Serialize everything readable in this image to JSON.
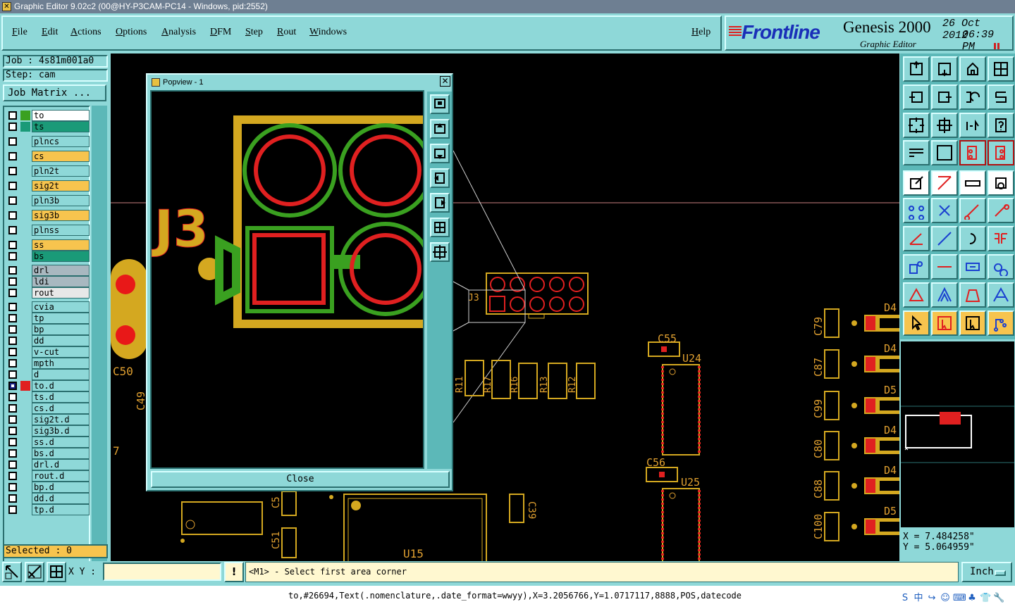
{
  "window": {
    "title": "Graphic Editor 9.02c2 (00@HY-P3CAM-PC14 - Windows, pid:2552)"
  },
  "menu": {
    "items": [
      "File",
      "Edit",
      "Actions",
      "Options",
      "Analysis",
      "DFM",
      "Step",
      "Rout",
      "Windows"
    ],
    "help": "Help"
  },
  "brand": {
    "logo": "Frontline",
    "product": "Genesis 2000",
    "subtitle": "Graphic Editor",
    "date": "26 Oct 2012",
    "time": "06:39 PM"
  },
  "job": {
    "job_label": "Job : 4s81m001a0",
    "step_label": "Step: cam",
    "matrix_button": "Job Matrix ..."
  },
  "layers": [
    {
      "name": "to",
      "color": "#ffffff",
      "swatch": "#3aa020",
      "checked": false
    },
    {
      "name": "ts",
      "color": "#1a9a78",
      "swatch": "#1a9a78",
      "checked": false
    },
    {
      "name": "plncs",
      "color": "#8ed8d8",
      "swatch": "",
      "checked": false
    },
    {
      "name": "cs",
      "color": "#f7c44e",
      "swatch": "",
      "checked": false
    },
    {
      "name": "pln2t",
      "color": "#8ed8d8",
      "swatch": "",
      "checked": false
    },
    {
      "name": "sig2t",
      "color": "#f7c44e",
      "swatch": "",
      "checked": false
    },
    {
      "name": "pln3b",
      "color": "#8ed8d8",
      "swatch": "",
      "checked": false
    },
    {
      "name": "sig3b",
      "color": "#f7c44e",
      "swatch": "",
      "checked": false
    },
    {
      "name": "plnss",
      "color": "#8ed8d8",
      "swatch": "",
      "checked": false
    },
    {
      "name": "ss",
      "color": "#f7c44e",
      "swatch": "",
      "checked": false
    },
    {
      "name": "bs",
      "color": "#1a9a78",
      "swatch": "",
      "checked": false
    },
    {
      "name": "drl",
      "color": "#a8b8c0",
      "swatch": "",
      "checked": false
    },
    {
      "name": "ldi",
      "color": "#a8b8c0",
      "swatch": "",
      "checked": false
    },
    {
      "name": "rout",
      "color": "#e8e8e8",
      "swatch": "",
      "checked": false
    },
    {
      "name": "cvia",
      "color": "#8ed8d8",
      "swatch": "",
      "checked": false
    },
    {
      "name": "tp",
      "color": "#8ed8d8",
      "swatch": "",
      "checked": false
    },
    {
      "name": "bp",
      "color": "#8ed8d8",
      "swatch": "",
      "checked": false
    },
    {
      "name": "dd",
      "color": "#8ed8d8",
      "swatch": "",
      "checked": false
    },
    {
      "name": "v-cut",
      "color": "#8ed8d8",
      "swatch": "",
      "checked": false
    },
    {
      "name": "mpth",
      "color": "#8ed8d8",
      "swatch": "",
      "checked": false
    },
    {
      "name": "d",
      "color": "#8ed8d8",
      "swatch": "",
      "checked": false
    },
    {
      "name": "to.d",
      "color": "#8ed8d8",
      "swatch": "#e02020",
      "checked": true
    },
    {
      "name": "ts.d",
      "color": "#8ed8d8",
      "swatch": "",
      "checked": false
    },
    {
      "name": "cs.d",
      "color": "#8ed8d8",
      "swatch": "",
      "checked": false
    },
    {
      "name": "sig2t.d",
      "color": "#8ed8d8",
      "swatch": "",
      "checked": false
    },
    {
      "name": "sig3b.d",
      "color": "#8ed8d8",
      "swatch": "",
      "checked": false
    },
    {
      "name": "ss.d",
      "color": "#8ed8d8",
      "swatch": "",
      "checked": false
    },
    {
      "name": "bs.d",
      "color": "#8ed8d8",
      "swatch": "",
      "checked": false
    },
    {
      "name": "drl.d",
      "color": "#8ed8d8",
      "swatch": "",
      "checked": false
    },
    {
      "name": "rout.d",
      "color": "#8ed8d8",
      "swatch": "",
      "checked": false
    },
    {
      "name": "bp.d",
      "color": "#8ed8d8",
      "swatch": "",
      "checked": false
    },
    {
      "name": "dd.d",
      "color": "#8ed8d8",
      "swatch": "",
      "checked": false
    },
    {
      "name": "tp.d",
      "color": "#8ed8d8",
      "swatch": "",
      "checked": false
    }
  ],
  "selected": "Selected : 0",
  "popview": {
    "title": "Popview - 1",
    "close_x": "✕",
    "close_button": "Close",
    "designator": "J3"
  },
  "canvas_labels": {
    "c50": "C50",
    "c49": "C49",
    "seven": "7",
    "j3": "J3",
    "r11": "R11",
    "r17": "R17",
    "r16": "R16",
    "r13": "R13",
    "r12": "R12",
    "c55": "C55",
    "u24": "U24",
    "c56": "C56",
    "u25": "U25",
    "u15": "U15",
    "c5a": "C5",
    "c51": "C51",
    "c39": "C39",
    "c79": "C79",
    "c87": "C87",
    "c99": "C99",
    "c80": "C80",
    "c88": "C88",
    "c100": "C100",
    "d4a": "D4",
    "d4b": "D4",
    "d5a": "D5",
    "d4c": "D4",
    "d4d": "D4",
    "d5b": "D5"
  },
  "coords": {
    "x": "X = 7.484258\"",
    "y": "Y = 5.064959\""
  },
  "bottom": {
    "xy_label": "X Y :",
    "xy_value": "",
    "warn": "!",
    "prompt": "<M1> - Select first area corner",
    "units": "Inch"
  },
  "status": {
    "text": "to,#26694,Text(.nomenclature,.date_format=wwyy),X=3.2056766,Y=1.0717117,8888,POS,datecode"
  },
  "tray_icons": [
    "S",
    "中",
    "↪",
    "☺",
    "⌨",
    "♣",
    "👕",
    "🔧"
  ]
}
